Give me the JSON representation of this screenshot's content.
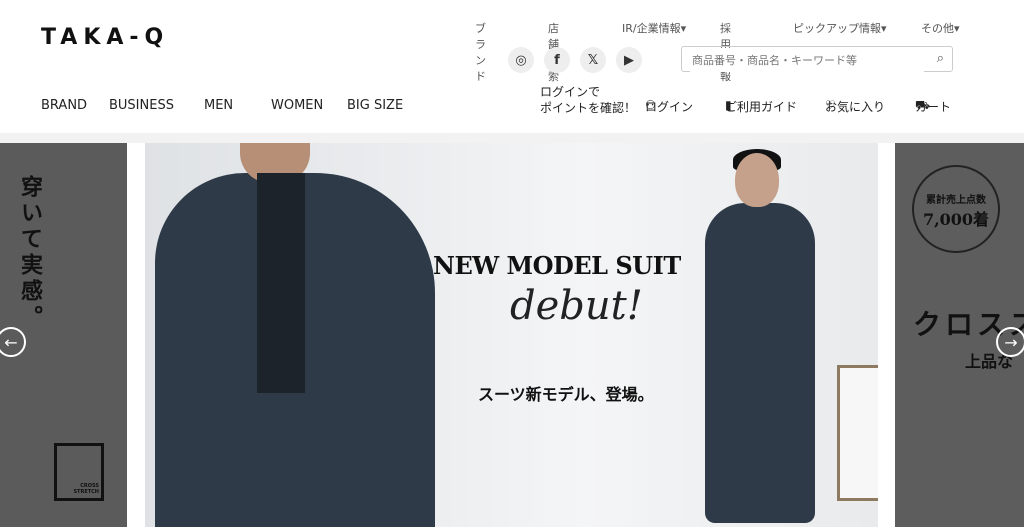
{
  "header": {
    "logo": "TAKA-Q",
    "top_links": [
      {
        "label": "ブランド"
      },
      {
        "label": "店舗検索"
      },
      {
        "label": "IR/企業情報"
      },
      {
        "label": "採用情報"
      },
      {
        "label": "ピックアップ情報"
      },
      {
        "label": "その他"
      }
    ],
    "search": {
      "placeholder": "商品番号・商品名・キーワード等"
    },
    "main_nav": [
      "BRAND",
      "BUSINESS",
      "MEN",
      "WOMEN",
      "BIG SIZE"
    ],
    "login_note_line1": "ログインで",
    "login_note_line2": "ポイントを確認！",
    "util": {
      "login": "ログイン",
      "guide": "ご利用ガイド",
      "favorites": "お気に入り",
      "cart": "カート"
    }
  },
  "slider": {
    "left_vertical_text": "穿いて実感。",
    "left_brand_mark": "CROSS STRETCH",
    "title": "NEW MODEL SUIT",
    "debut": "debut!",
    "subtitle": "スーツ新モデル、登場。",
    "badge_line1": "累計売上点数",
    "badge_line2": "7,000着",
    "right_text1": "クロスス",
    "right_text2": "上品な",
    "prev_arrow": "←",
    "next_arrow": "→"
  },
  "colors": {
    "side_panel": "#5b5b5b",
    "suit": "#2f3a48"
  }
}
